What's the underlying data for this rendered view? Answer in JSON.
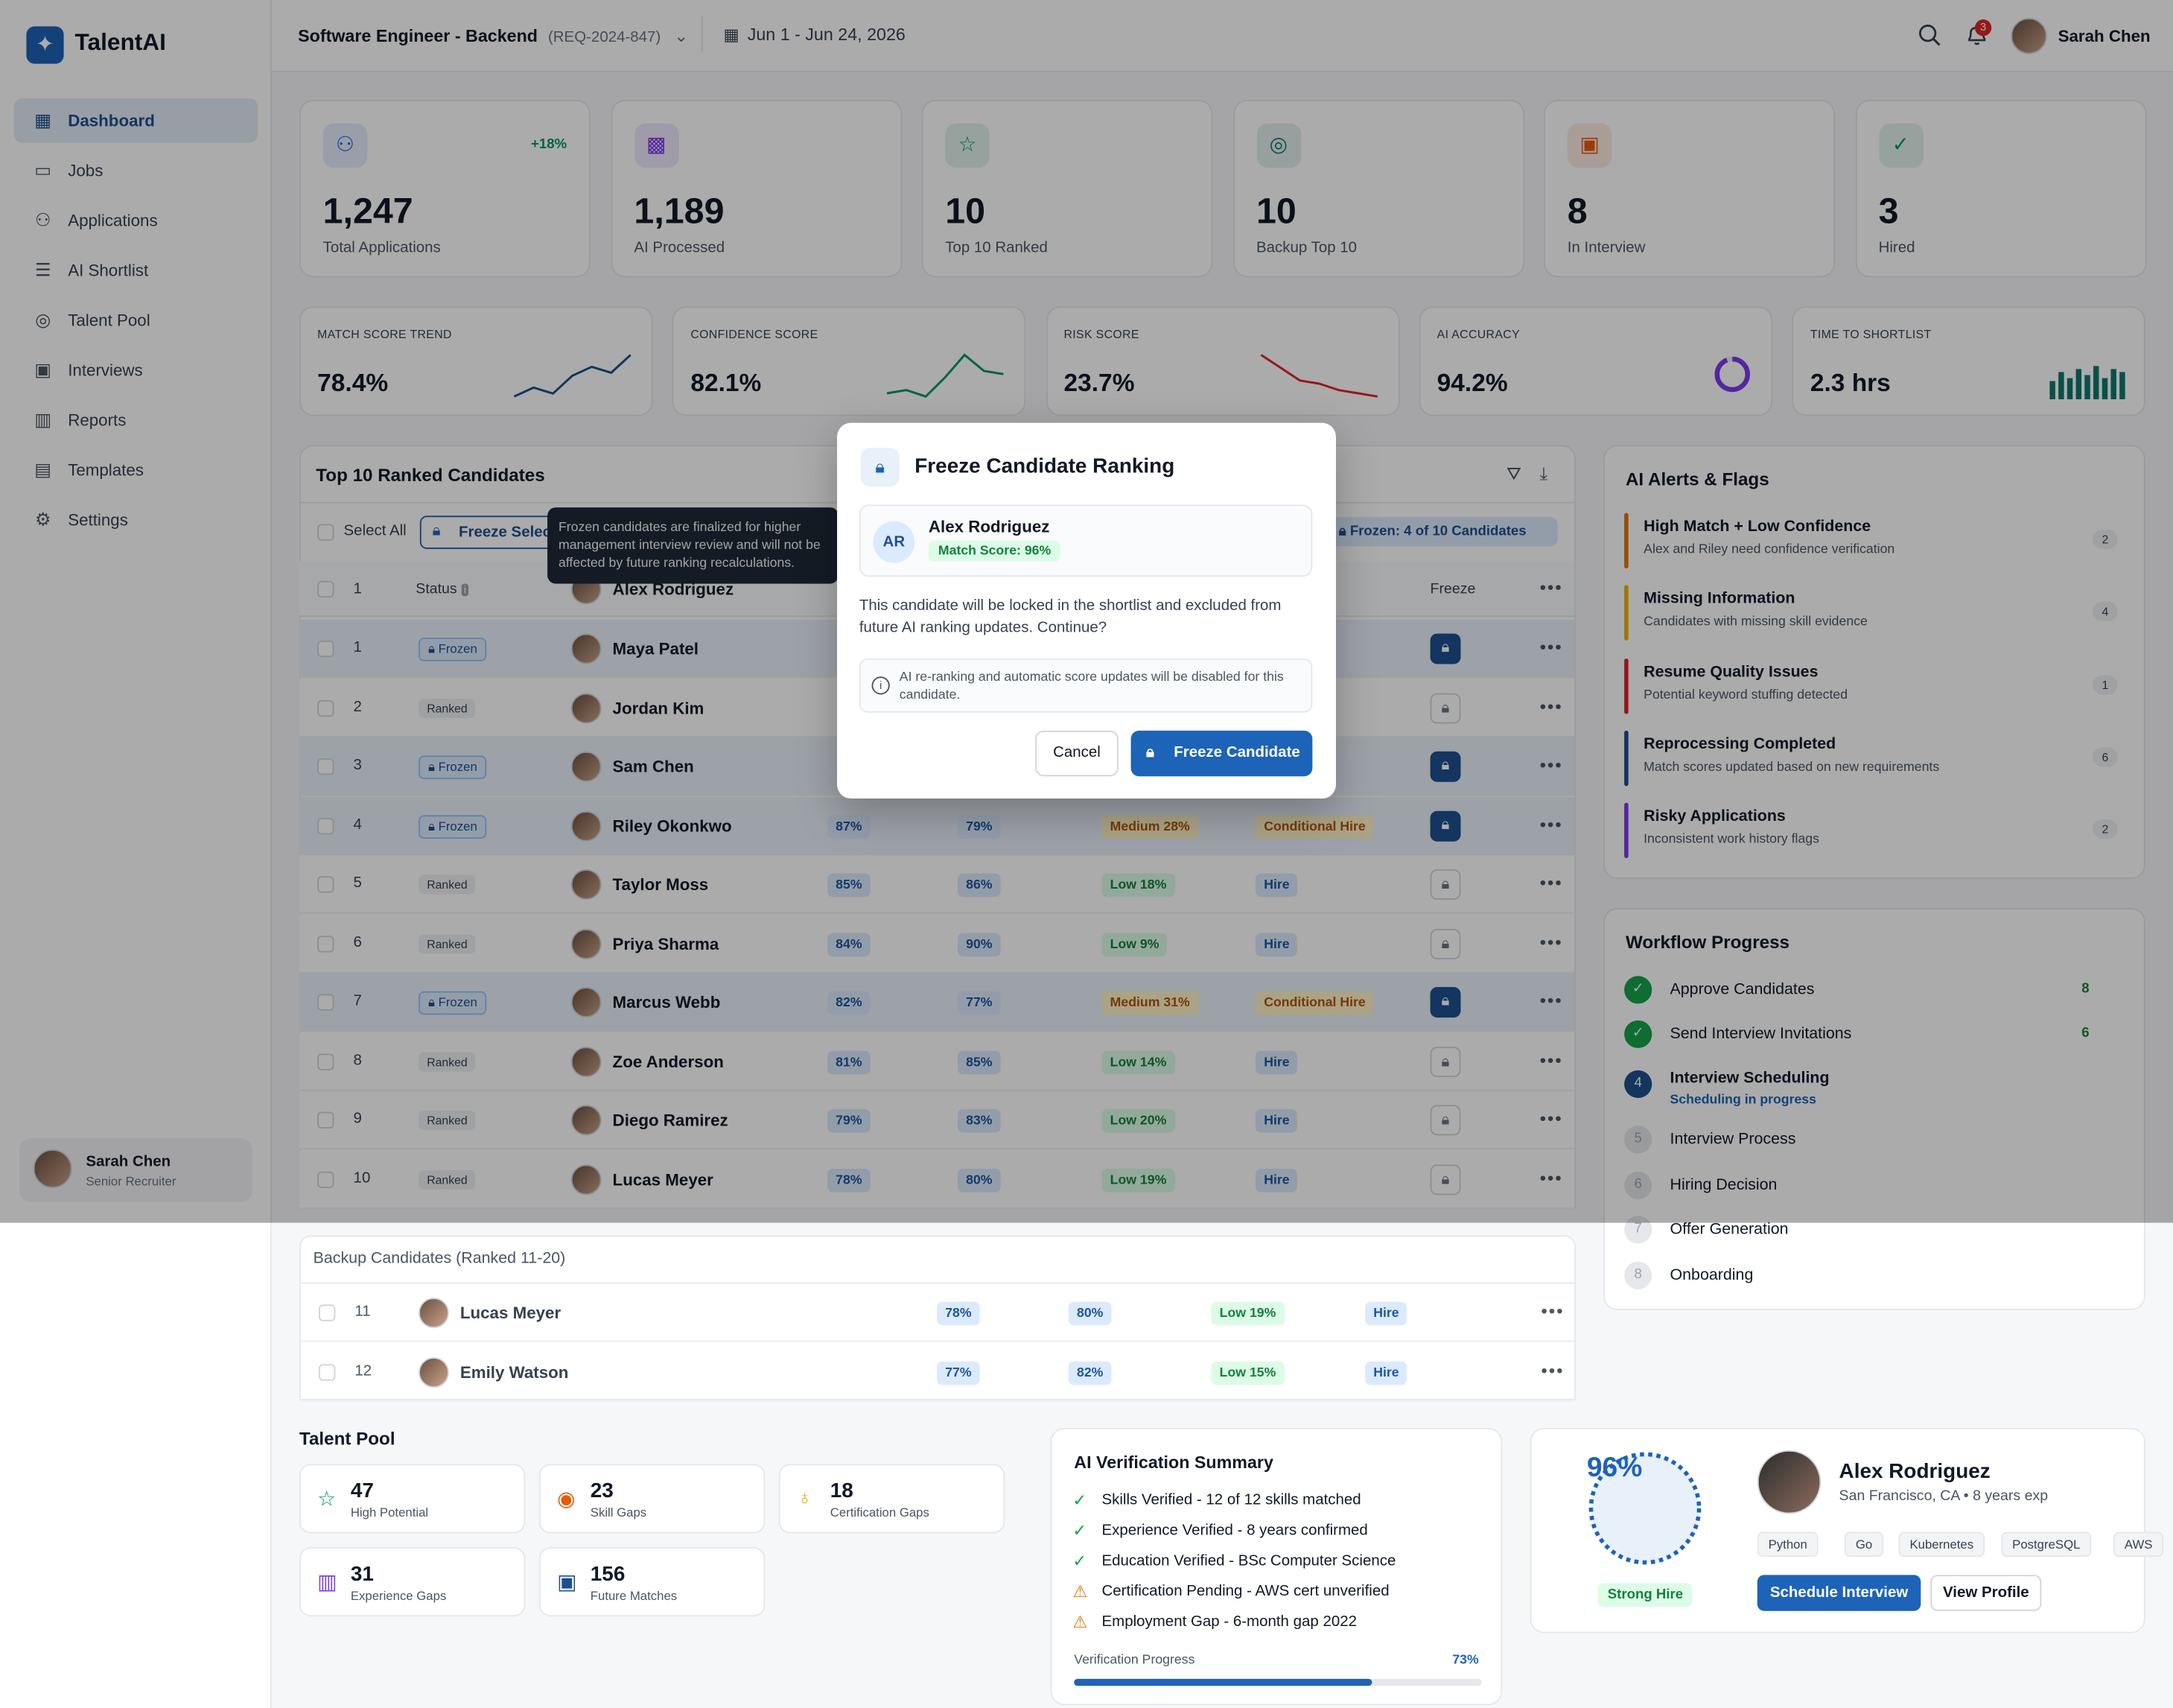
{
  "app": {
    "name": "TalentAI"
  },
  "sidebar": {
    "items": [
      {
        "label": "Dashboard",
        "icon": "grid-icon"
      },
      {
        "label": "Jobs",
        "icon": "briefcase-icon"
      },
      {
        "label": "Applications",
        "icon": "users-icon"
      },
      {
        "label": "AI Shortlist",
        "icon": "list-check-icon"
      },
      {
        "label": "Talent Pool",
        "icon": "database-icon"
      },
      {
        "label": "Interviews",
        "icon": "calendar-icon"
      },
      {
        "label": "Reports",
        "icon": "bar-chart-icon"
      },
      {
        "label": "Templates",
        "icon": "document-icon"
      },
      {
        "label": "Settings",
        "icon": "gear-icon"
      }
    ],
    "user": {
      "name": "Sarah Chen",
      "role": "Senior Recruiter"
    }
  },
  "header": {
    "job_title": "Software Engineer - Backend",
    "req_id": "(REQ-2024-847)",
    "date_range": "Jun 1 - Jun 24, 2026",
    "notif_count": "3",
    "user_name": "Sarah Chen"
  },
  "stats": [
    {
      "value": "1,247",
      "label": "Total Applications",
      "delta": "+18%",
      "icon": "users-icon",
      "color": "#2563eb"
    },
    {
      "value": "1,189",
      "label": "AI Processed",
      "icon": "chip-icon",
      "color": "#7c3aed"
    },
    {
      "value": "10",
      "label": "Top 10 Ranked",
      "icon": "star-icon",
      "color": "#059669"
    },
    {
      "value": "10",
      "label": "Backup Top 10",
      "icon": "database-icon",
      "color": "#0f766e"
    },
    {
      "value": "8",
      "label": "In Interview",
      "icon": "calendar-icon",
      "color": "#ea580c"
    },
    {
      "value": "3",
      "label": "Hired",
      "icon": "check-circle-icon",
      "color": "#059669"
    }
  ],
  "metrics": [
    {
      "label": "MATCH SCORE TREND",
      "value": "78.4%",
      "spark": [
        2,
        5,
        3,
        9,
        12,
        10,
        16
      ],
      "color": "#1d4f8f"
    },
    {
      "label": "CONFIDENCE SCORE",
      "value": "82.1%",
      "spark": [
        2,
        3,
        1,
        7,
        14,
        9,
        8
      ],
      "color": "#059669"
    },
    {
      "label": "RISK SCORE",
      "value": "23.7%",
      "spark": [
        16,
        12,
        8,
        7,
        5,
        4,
        3
      ],
      "color": "#dc2626"
    },
    {
      "label": "AI ACCURACY",
      "value": "94.2%",
      "ring": 0.942,
      "color": "#7c3aed"
    },
    {
      "label": "TIME TO SHORTLIST",
      "value": "2.3 hrs",
      "bars": [
        6,
        9,
        7,
        10,
        8,
        11,
        7,
        10,
        9
      ],
      "color": "#0f766e"
    }
  ],
  "table": {
    "title": "Top 10 Ranked Candidates",
    "select_all": "Select All",
    "freeze_selected": "Freeze Selec",
    "frozen_count": "Frozen: 4 of 10 Candidates",
    "tooltip": "Frozen candidates are finalized for higher management interview review and will not be affected by future ranking recalculations.",
    "headers": {
      "status": "Status",
      "freeze": "Freeze",
      "header_row_num": "1",
      "header_row_name": "Alex Rodriguez"
    },
    "rows": [
      {
        "rank": "1",
        "status": "Frozen",
        "name": "Maya Patel",
        "frozen": true
      },
      {
        "rank": "2",
        "status": "Ranked",
        "name": "Jordan Kim",
        "frozen": false
      },
      {
        "rank": "3",
        "status": "Frozen",
        "name": "Sam Chen",
        "frozen": true
      },
      {
        "rank": "4",
        "status": "Frozen",
        "name": "Riley Okonkwo",
        "match": "87%",
        "conf": "79%",
        "risk": "Medium 28%",
        "rec": "Conditional Hire",
        "frozen": true
      },
      {
        "rank": "5",
        "status": "Ranked",
        "name": "Taylor Moss",
        "match": "85%",
        "conf": "86%",
        "risk": "Low 18%",
        "rec": "Hire",
        "frozen": false
      },
      {
        "rank": "6",
        "status": "Ranked",
        "name": "Priya Sharma",
        "match": "84%",
        "conf": "90%",
        "risk": "Low 9%",
        "rec": "Hire",
        "frozen": false
      },
      {
        "rank": "7",
        "status": "Frozen",
        "name": "Marcus Webb",
        "match": "82%",
        "conf": "77%",
        "risk": "Medium 31%",
        "rec": "Conditional Hire",
        "frozen": true
      },
      {
        "rank": "8",
        "status": "Ranked",
        "name": "Zoe Anderson",
        "match": "81%",
        "conf": "85%",
        "risk": "Low 14%",
        "rec": "Hire",
        "frozen": false
      },
      {
        "rank": "9",
        "status": "Ranked",
        "name": "Diego Ramirez",
        "match": "79%",
        "conf": "83%",
        "risk": "Low 20%",
        "rec": "Hire",
        "frozen": false
      },
      {
        "rank": "10",
        "status": "Ranked",
        "name": "Lucas Meyer",
        "match": "78%",
        "conf": "80%",
        "risk": "Low 19%",
        "rec": "Hire",
        "frozen": false
      }
    ]
  },
  "backup": {
    "title": "Backup Candidates (Ranked 11-20)",
    "rows": [
      {
        "rank": "11",
        "name": "Lucas Meyer",
        "match": "78%",
        "conf": "80%",
        "risk": "Low 19%",
        "rec": "Hire"
      },
      {
        "rank": "12",
        "name": "Emily Watson",
        "match": "77%",
        "conf": "82%",
        "risk": "Low 15%",
        "rec": "Hire"
      }
    ]
  },
  "alerts": {
    "title": "AI Alerts & Flags",
    "items": [
      {
        "title": "High Match + Low Confidence",
        "sub": "Alex and Riley need confidence verification",
        "count": "2",
        "color": "#d97706"
      },
      {
        "title": "Missing Information",
        "sub": "Candidates with missing skill evidence",
        "count": "4",
        "color": "#eab308"
      },
      {
        "title": "Resume Quality Issues",
        "sub": "Potential keyword stuffing detected",
        "count": "1",
        "color": "#dc2626"
      },
      {
        "title": "Reprocessing Completed",
        "sub": "Match scores updated based on new requirements",
        "count": "6",
        "color": "#1d4f8f"
      },
      {
        "title": "Risky Applications",
        "sub": "Inconsistent work history flags",
        "count": "2",
        "color": "#7c3aed"
      }
    ]
  },
  "workflow": {
    "title": "Workflow Progress",
    "steps": [
      {
        "label": "Approve Candidates",
        "count": "8",
        "state": "done"
      },
      {
        "label": "Send Interview Invitations",
        "count": "6",
        "state": "done"
      },
      {
        "label": "Interview Scheduling",
        "sub": "Scheduling in progress",
        "num": "4",
        "state": "active"
      },
      {
        "label": "Interview Process",
        "num": "5",
        "state": "todo"
      },
      {
        "label": "Hiring Decision",
        "num": "6",
        "state": "todo"
      },
      {
        "label": "Offer Generation",
        "num": "7",
        "state": "todo"
      },
      {
        "label": "Onboarding",
        "num": "8",
        "state": "todo"
      }
    ]
  },
  "talent_pool": {
    "title": "Talent Pool",
    "cards": [
      {
        "value": "47",
        "label": "High Potential",
        "icon": "star-icon",
        "color": "#059669"
      },
      {
        "value": "23",
        "label": "Skill Gaps",
        "icon": "target-icon",
        "color": "#ea580c"
      },
      {
        "value": "18",
        "label": "Certification Gaps",
        "icon": "award-icon",
        "color": "#eab308"
      },
      {
        "value": "31",
        "label": "Experience Gaps",
        "icon": "bar-chart-icon",
        "color": "#7c3aed"
      },
      {
        "value": "156",
        "label": "Future Matches",
        "icon": "calendar-icon",
        "color": "#1d4f8f"
      }
    ]
  },
  "verification": {
    "title": "AI Verification Summary",
    "items": [
      {
        "text": "Skills Verified - 12 of 12 skills matched",
        "ok": true
      },
      {
        "text": "Experience Verified - 8 years confirmed",
        "ok": true
      },
      {
        "text": "Education Verified - BSc Computer Science",
        "ok": true
      },
      {
        "text": "Certification Pending - AWS cert unverified",
        "ok": false
      },
      {
        "text": "Employment Gap - 6-month gap 2022",
        "ok": false
      }
    ],
    "progress_label": "Verification Progress",
    "progress_value": "73%",
    "progress": 0.73
  },
  "profile": {
    "score": "96%",
    "score_value": 0.96,
    "verdict": "Strong Hire",
    "name": "Alex Rodriguez",
    "meta": "San Francisco, CA • 8 years exp",
    "skills": [
      "Python",
      "Go",
      "Kubernetes",
      "PostgreSQL",
      "AWS"
    ],
    "schedule_label": "Schedule Interview",
    "view_label": "View Profile"
  },
  "modal": {
    "title": "Freeze Candidate Ranking",
    "initials": "AR",
    "candidate": "Alex Rodriguez",
    "match": "Match Score: 96%",
    "body": "This candidate will be locked in the shortlist and excluded from future AI ranking updates. Continue?",
    "info": "AI re-ranking and automatic score updates will be disabled for this candidate.",
    "cancel": "Cancel",
    "confirm": "Freeze Candidate"
  },
  "colors": {
    "primary": "#1d63b8",
    "frozen_bg": "#eaf1fb",
    "success": "#059669"
  }
}
